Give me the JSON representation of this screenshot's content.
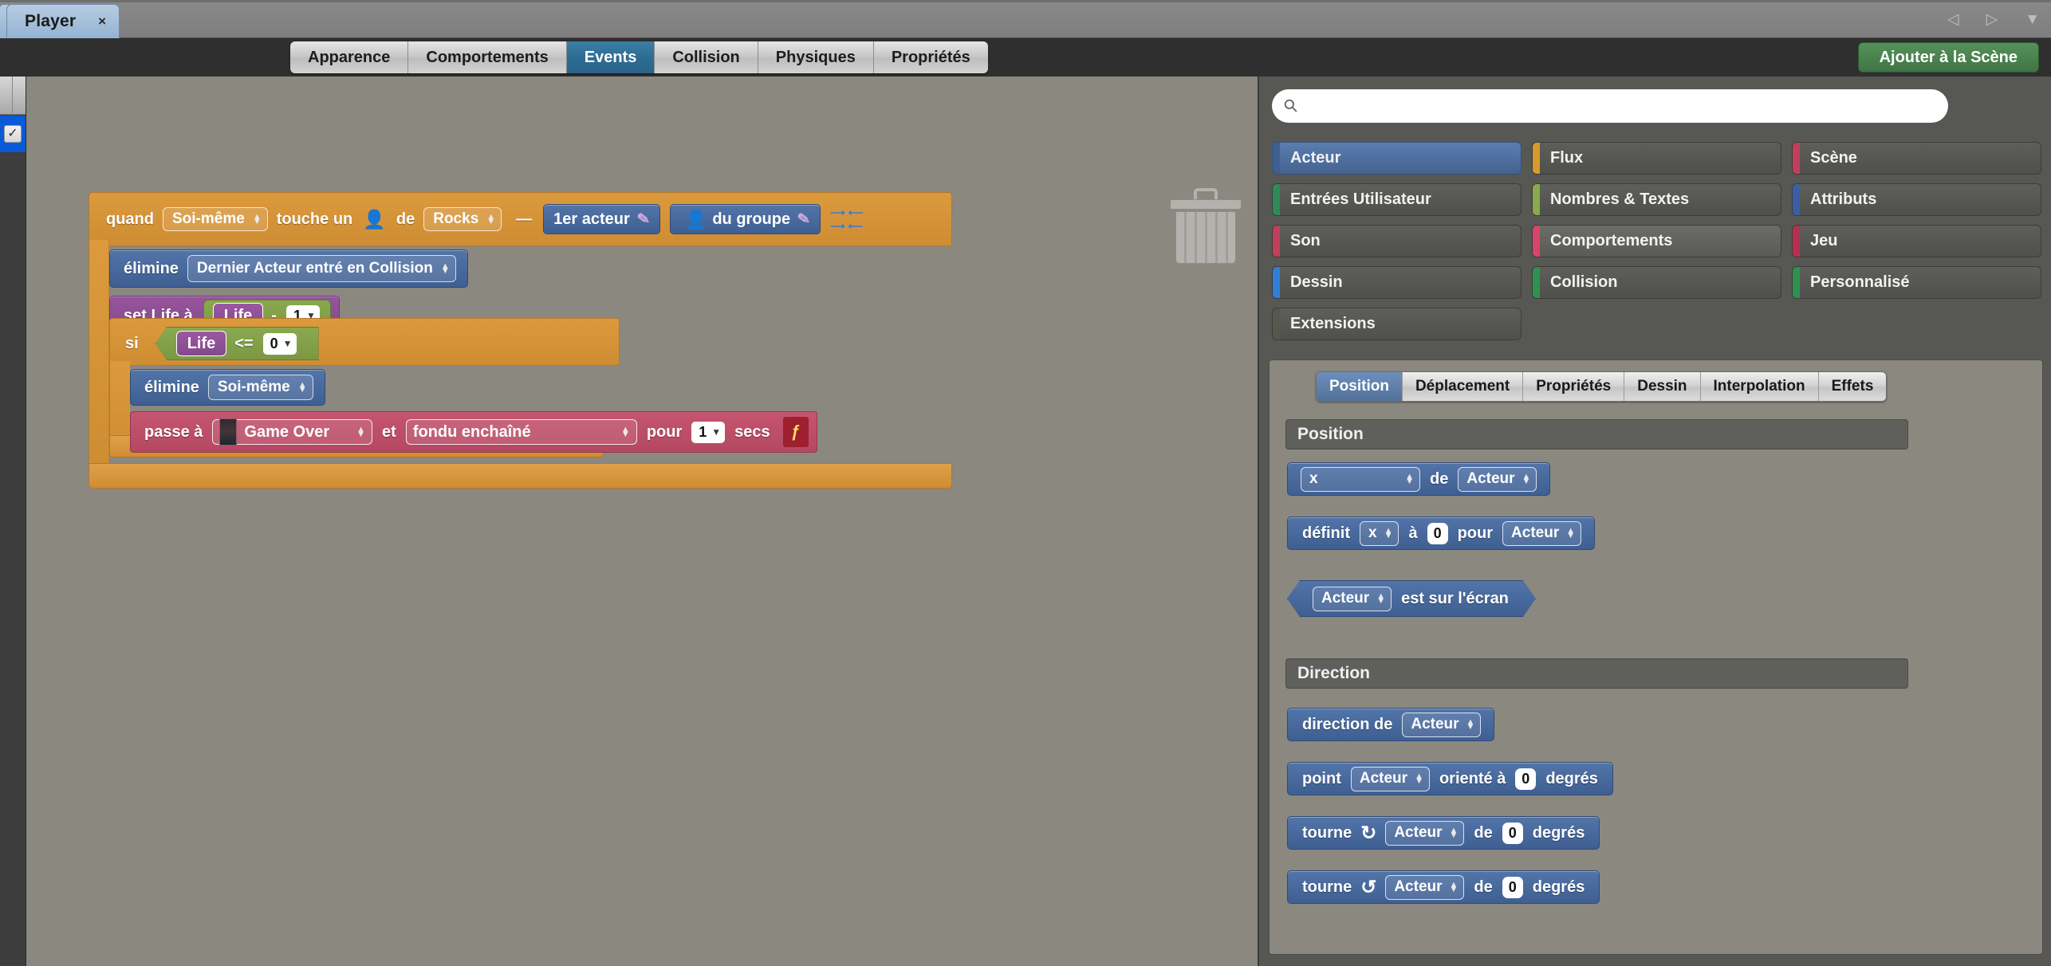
{
  "window": {
    "document_tab": {
      "label": "Player",
      "close": "×"
    },
    "nav": {
      "prev": "◁",
      "next": "▷",
      "menu": "▼"
    }
  },
  "toolbar": {
    "tabs": [
      {
        "label": "Apparence",
        "selected": false
      },
      {
        "label": "Comportements",
        "selected": false
      },
      {
        "label": "Events",
        "selected": true
      },
      {
        "label": "Collision",
        "selected": false
      },
      {
        "label": "Physiques",
        "selected": false
      },
      {
        "label": "Propriétés",
        "selected": false
      }
    ],
    "add_to_scene": "Ajouter à la Scène"
  },
  "canvas": {
    "trash": "trash-can",
    "event": {
      "hat": {
        "word_quand": "quand",
        "self_dropdown": "Soi-même",
        "word_touche": "touche un",
        "word_de": "de",
        "group_dropdown": "Rocks",
        "dash": "—",
        "first_actor": "1er acteur",
        "of_group": "du groupe",
        "collapse": "collapse-arrows"
      },
      "kill_last": {
        "verb": "élimine",
        "target": "Dernier Acteur entré en Collision"
      },
      "set_life": {
        "prefix": "set Life à",
        "var": "Life",
        "op": "-",
        "value": "1"
      },
      "if_block": {
        "keyword": "si",
        "var": "Life",
        "op": "<=",
        "value": "0"
      },
      "kill_self": {
        "verb": "élimine",
        "target": "Soi-même"
      },
      "switch_scene": {
        "prefix": "passe à",
        "scene": "Game Over",
        "and": "et",
        "transition": "fondu enchaîné",
        "for": "pour",
        "secs_value": "1",
        "secs_label": "secs",
        "bolt": "ƒ"
      }
    }
  },
  "right": {
    "search": {
      "value": "",
      "placeholder": "",
      "icon": "search-icon"
    },
    "categories": [
      {
        "label": "Acteur",
        "color": "#3f5f92",
        "state": "selected"
      },
      {
        "label": "Flux",
        "color": "#d89a2e",
        "state": "normal"
      },
      {
        "label": "Scène",
        "color": "#c0405c",
        "state": "normal"
      },
      {
        "label": "Entrées Utilisateur",
        "color": "#2f8a55",
        "state": "normal"
      },
      {
        "label": "Nombres & Textes",
        "color": "#8aa84e",
        "state": "normal"
      },
      {
        "label": "Attributs",
        "color": "#3a5fa8",
        "state": "normal"
      },
      {
        "label": "Son",
        "color": "#c0405c",
        "state": "normal"
      },
      {
        "label": "Comportements",
        "color": "#d6456b",
        "state": "hover"
      },
      {
        "label": "Jeu",
        "color": "#b8304f",
        "state": "normal"
      },
      {
        "label": "Dessin",
        "color": "#2f7fd8",
        "state": "normal"
      },
      {
        "label": "Collision",
        "color": "#2f9150",
        "state": "normal"
      },
      {
        "label": "Personnalisé",
        "color": "#2f9150",
        "state": "normal"
      },
      {
        "label": "Extensions",
        "color": "#57574f",
        "state": "normal"
      }
    ],
    "subtabs": [
      {
        "label": "Position",
        "selected": true
      },
      {
        "label": "Déplacement",
        "selected": false
      },
      {
        "label": "Propriétés",
        "selected": false
      },
      {
        "label": "Dessin",
        "selected": false
      },
      {
        "label": "Interpolation",
        "selected": false
      },
      {
        "label": "Effets",
        "selected": false
      }
    ],
    "section_position": "Position",
    "section_direction": "Direction",
    "blocks": {
      "get_x": {
        "coord": "x",
        "de": "de",
        "actor": "Acteur"
      },
      "set_x": {
        "verb": "définit",
        "coord": "x",
        "a": "à",
        "value": "0",
        "pour": "pour",
        "actor": "Acteur"
      },
      "on_screen": {
        "actor": "Acteur",
        "text": "est sur l'écran"
      },
      "direction": {
        "text": "direction de",
        "actor": "Acteur"
      },
      "point_at": {
        "verb": "point",
        "actor": "Acteur",
        "mid": "orienté à",
        "value": "0",
        "unit": "degrés"
      },
      "turn_cw": {
        "verb": "tourne",
        "icon": "rotate-cw-icon",
        "glyph": "↻",
        "actor": "Acteur",
        "de": "de",
        "value": "0",
        "unit": "degrés"
      },
      "turn_ccw": {
        "verb": "tourne",
        "icon": "rotate-ccw-icon",
        "glyph": "↺",
        "actor": "Acteur",
        "de": "de",
        "value": "0",
        "unit": "degrés"
      }
    }
  }
}
